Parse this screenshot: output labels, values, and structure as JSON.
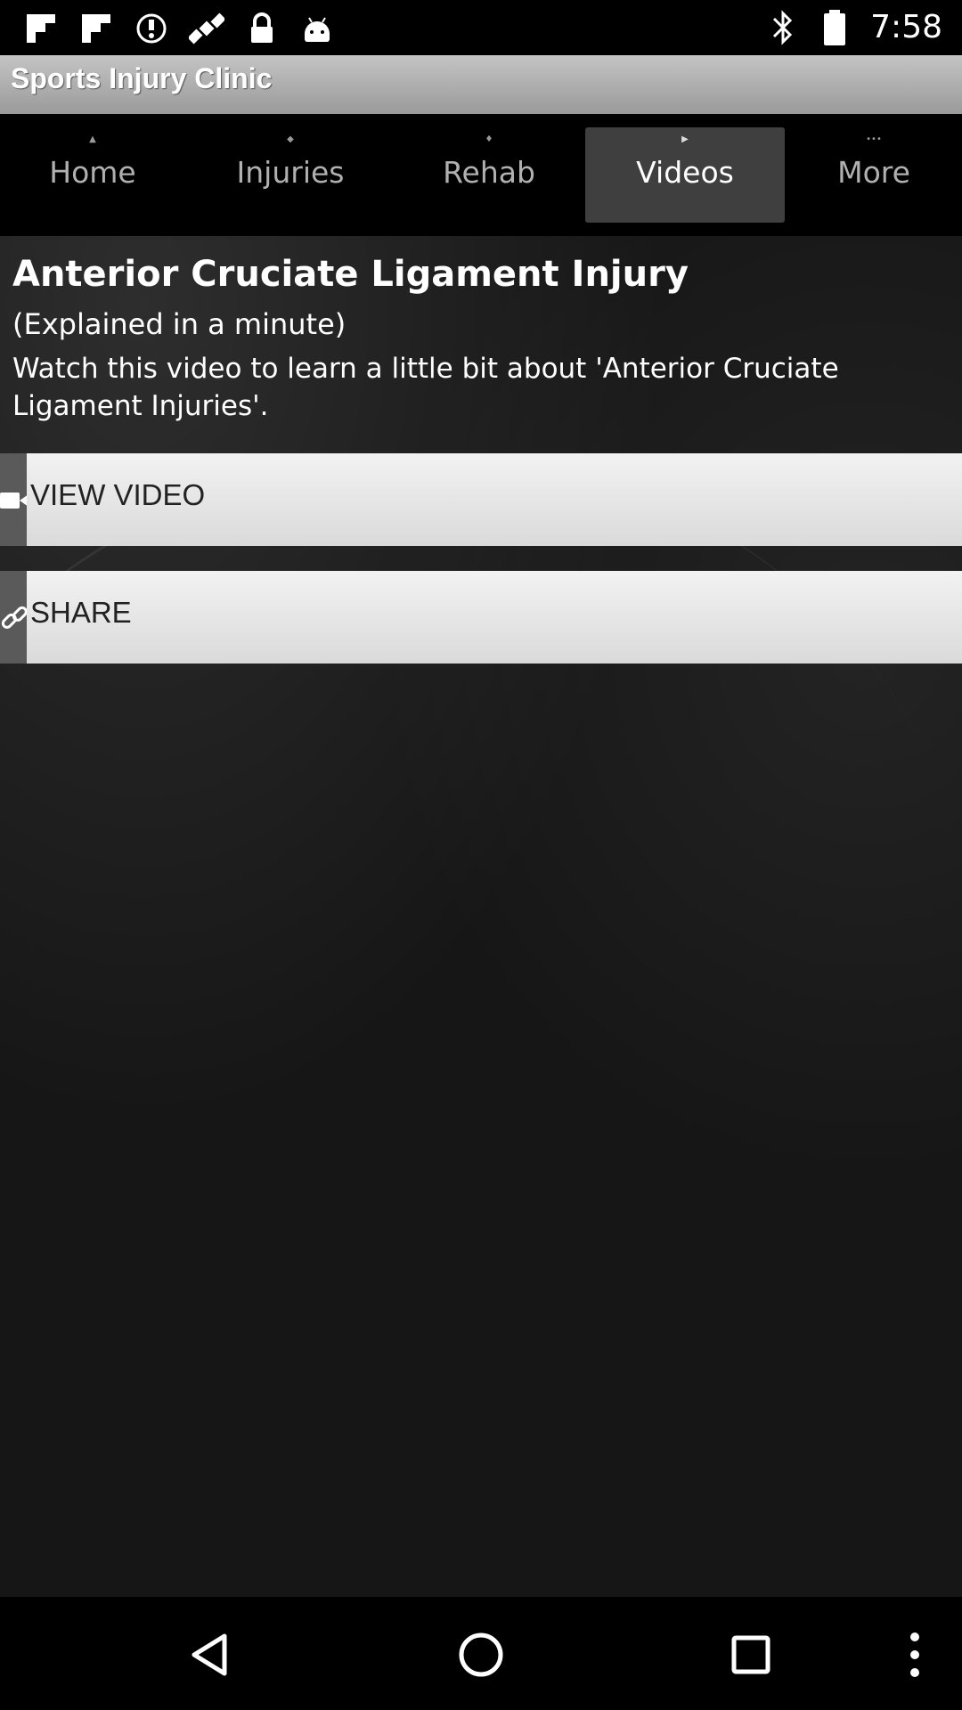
{
  "status_bar": {
    "time": "7:58",
    "icons_left": [
      "flipboard-icon",
      "flipboard-icon",
      "sync-icon",
      "satellite-icon",
      "lock-icon",
      "android-icon"
    ],
    "icons_right": [
      "bluetooth-icon",
      "battery-icon"
    ]
  },
  "app": {
    "title": "Sports Injury Clinic"
  },
  "tabs": [
    {
      "label": "Home",
      "active": false
    },
    {
      "label": "Injuries",
      "active": false
    },
    {
      "label": "Rehab",
      "active": false
    },
    {
      "label": "Videos",
      "active": true
    },
    {
      "label": "More",
      "active": false
    }
  ],
  "video": {
    "title": "Anterior Cruciate Ligament Injury",
    "subtitle": "(Explained in a minute)",
    "description": "Watch this video to learn a little bit about 'Anterior Cruciate Ligament Injuries'."
  },
  "actions": {
    "view_video_label": "VIEW VIDEO",
    "share_label": "SHARE"
  },
  "nav": {
    "back": "back-icon",
    "home": "home-icon",
    "recents": "recents-icon",
    "menu": "overflow-menu-icon"
  },
  "colors": {
    "title_bar": "#b3b3b3",
    "active_tab": "#3f3f3f",
    "action_row": "#e8e8e8",
    "background": "#161616"
  }
}
